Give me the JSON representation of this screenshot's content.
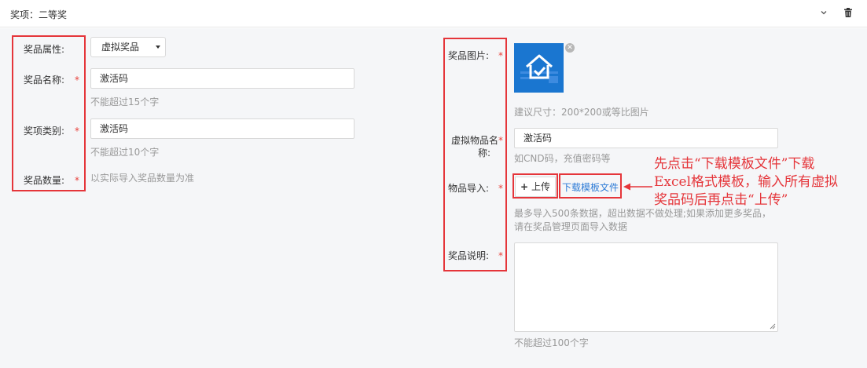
{
  "header": {
    "title": "奖项：二等奖",
    "collapse_icon": "chevron-down-icon",
    "delete_icon": "trash-icon"
  },
  "form_left": {
    "attr_label": "奖品属性:",
    "attr_value": "虚拟奖品",
    "name_label": "奖品名称:",
    "name_value": "激活码",
    "name_hint": "不能超过15个字",
    "category_label": "奖项类别:",
    "category_value": "激活码",
    "category_hint": "不能超过10个字",
    "qty_label": "奖品数量:",
    "qty_hint": "以实际导入奖品数量为准"
  },
  "form_right": {
    "image_label": "奖品图片:",
    "image_hint": "建议尺寸：200*200或等比图片",
    "virtual_name_label_1": "虚拟物品名",
    "virtual_name_label_2": "称:",
    "virtual_name_value": "激活码",
    "virtual_name_hint": "如CND码，充值密码等",
    "import_label": "物品导入:",
    "upload_label": "上传",
    "download_label": "下载模板文件",
    "import_hint_1": "最多导入500条数据，超出数据不做处理;如果添加更多奖品，",
    "import_hint_2": "请在奖品管理页面导入数据",
    "desc_label": "奖品说明:",
    "desc_value": "",
    "desc_hint": "不能超过100个字"
  },
  "required_mark": "*",
  "annotation": {
    "line1": "先点击“下载模板文件”下载",
    "line2": "Excel格式模板，输入所有虚拟",
    "line3": "奖品码后再点击“上传”",
    "color": "#e5353a"
  },
  "colors": {
    "required": "#e8413b",
    "link": "#2d7bd6",
    "highlight": "#e5353a",
    "form_bg": "#f5f6f8"
  }
}
